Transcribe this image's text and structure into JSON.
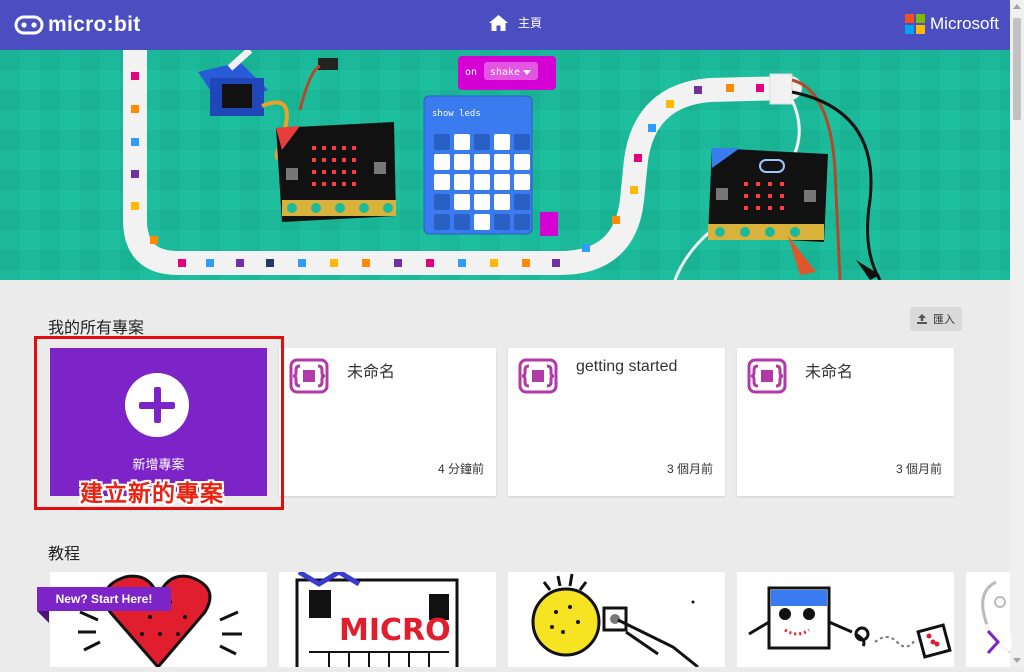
{
  "header": {
    "brand": "micro:bit",
    "home_label": "主頁",
    "microsoft_label": "Microsoft",
    "ms_colors": [
      "#f25022",
      "#7fba00",
      "#00a4ef",
      "#ffb900"
    ],
    "bg_color": "#4a4ec1"
  },
  "hero": {
    "block_on": "on",
    "block_shake": "shake",
    "block_show_leds": "show leds",
    "bg_color": "#1bb999"
  },
  "projects": {
    "section_title": "我的所有專案",
    "import_label": "匯入",
    "new_project_label": "新增專案",
    "items": [
      {
        "title": "未命名",
        "time": "4 分鐘前"
      },
      {
        "title": "getting started",
        "time": "3 個月前"
      },
      {
        "title": "未命名",
        "time": "3 個月前"
      }
    ],
    "accent_color": "#7c24c8"
  },
  "annotation": {
    "text": "建立新的專案",
    "color": "#e9230f"
  },
  "tutorials": {
    "section_title": "教程",
    "ribbon_label": "New? Start Here!",
    "items": [
      {
        "icon": "heart-drawing"
      },
      {
        "icon": "micro-robot-drawing",
        "drawn_text": "MICRO"
      },
      {
        "icon": "button-press-drawing"
      },
      {
        "icon": "dice-robot-drawing"
      },
      {
        "icon": "partial-drawing"
      }
    ]
  }
}
